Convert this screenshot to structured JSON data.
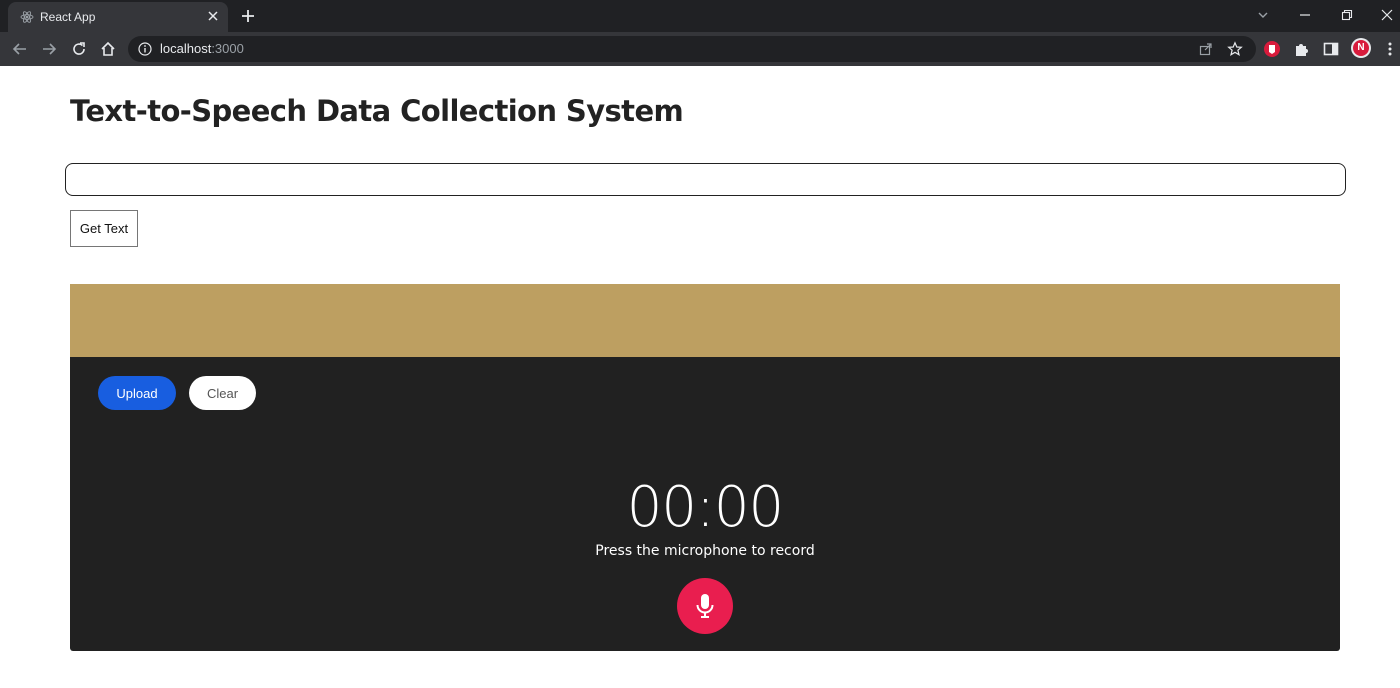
{
  "browser": {
    "tab_title": "React App",
    "url_host": "localhost",
    "url_port": ":3000",
    "avatar_letter": "N"
  },
  "page": {
    "title": "Text-to-Speech Data Collection System",
    "text_input_value": "",
    "get_text_label": "Get Text"
  },
  "recorder": {
    "upload_label": "Upload",
    "clear_label": "Clear",
    "timer": "00:00",
    "instruction": "Press the microphone to record"
  },
  "colors": {
    "header_band": "#bd9f61",
    "recorder_bg": "#212121",
    "upload_blue": "#185ee0",
    "mic_red": "#e91e4f"
  },
  "icons": [
    "react-icon",
    "close-icon",
    "plus-icon",
    "chevron-down-icon",
    "minimize-icon",
    "restore-icon",
    "window-close-icon",
    "back-icon",
    "forward-icon",
    "reload-icon",
    "home-icon",
    "info-icon",
    "share-icon",
    "star-icon",
    "extension-icon",
    "puzzle-icon",
    "sidebar-icon",
    "menu-icon",
    "microphone-icon"
  ]
}
